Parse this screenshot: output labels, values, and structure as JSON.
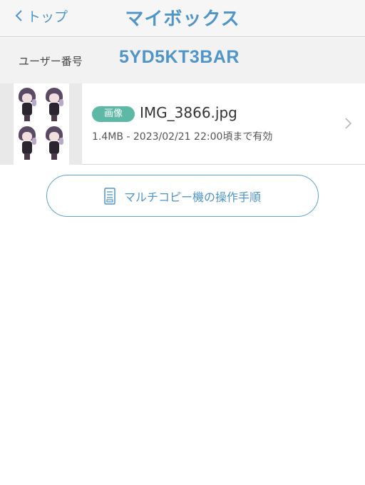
{
  "nav": {
    "back_label": "トップ",
    "title": "マイボックス"
  },
  "user": {
    "label": "ユーザー番号",
    "code": "5YD5KT3BAR"
  },
  "file": {
    "badge": "画像",
    "name": "IMG_3866.jpg",
    "meta": "1.4MB - 2023/02/21 22:00頃まで有効"
  },
  "manual_button": {
    "label": "マルチコピー機の操作手順"
  },
  "icons": {
    "back": "chevron-left-icon",
    "row": "chevron-right-icon",
    "manual": "document-icon"
  },
  "colors": {
    "accent": "#4f95c8",
    "badge": "#5db8a6",
    "navbar_bg": "#f6f6f6",
    "userbar_bg": "#f2f2f2"
  }
}
